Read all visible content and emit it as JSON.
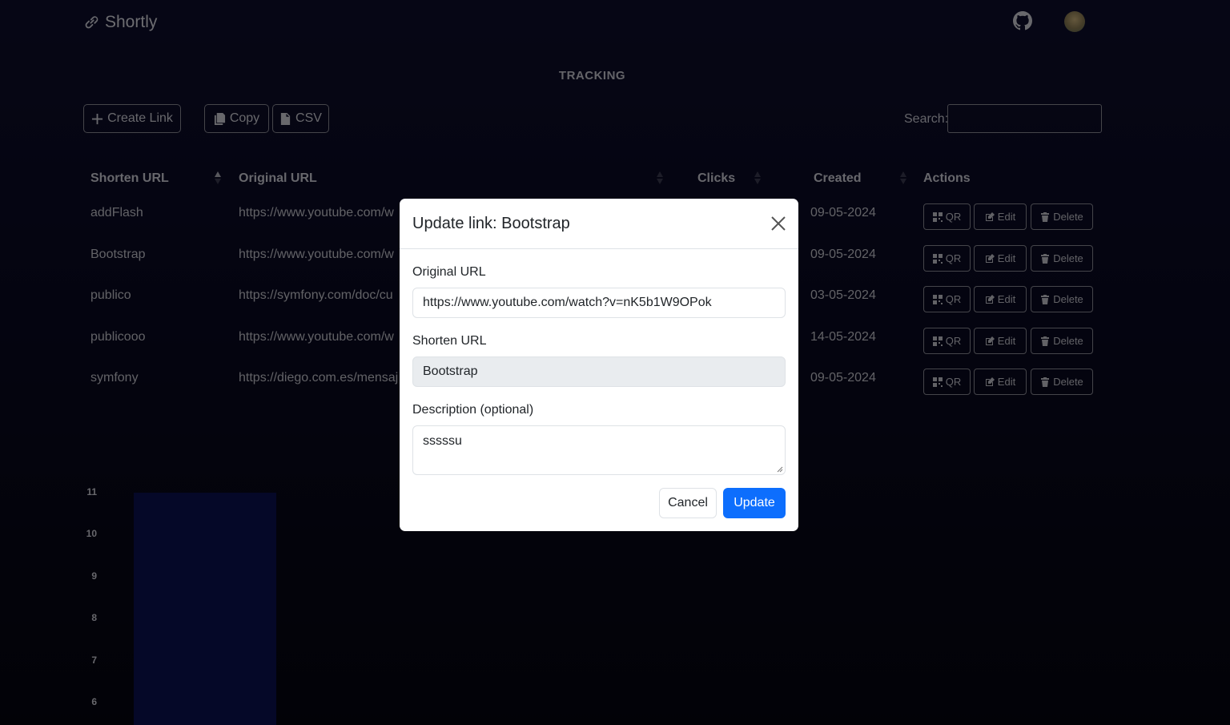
{
  "brand": {
    "name": "Shortly",
    "icon": "link-icon"
  },
  "header": {
    "github_icon": "github-icon",
    "avatar": "avatar"
  },
  "page": {
    "heading": "TRACKING"
  },
  "toolbar": {
    "create_label": "Create Link",
    "copy_label": "Copy",
    "csv_label": "CSV",
    "search_label": "Search:",
    "search_value": ""
  },
  "table": {
    "columns": [
      "Shorten URL",
      "Original URL",
      "Clicks",
      "Created",
      "Actions"
    ],
    "rows": [
      {
        "short": "addFlash",
        "original": "https://www.youtube.com/w",
        "created": "09-05-2024"
      },
      {
        "short": "Bootstrap",
        "original": "https://www.youtube.com/w",
        "created": "09-05-2024"
      },
      {
        "short": "publico",
        "original": "https://symfony.com/doc/cu",
        "created": "03-05-2024"
      },
      {
        "short": "publicooo",
        "original": "https://www.youtube.com/w",
        "created": "14-05-2024"
      },
      {
        "short": "symfony",
        "original": "https://diego.com.es/mensaj",
        "created": "09-05-2024"
      }
    ],
    "actions": {
      "qr": "QR",
      "edit": "Edit",
      "delete": "Delete"
    }
  },
  "chart_data": {
    "type": "bar",
    "y_ticks": [
      "11",
      "10",
      "9",
      "8",
      "7",
      "6"
    ],
    "ylim": [
      5.4,
      11
    ],
    "values": [
      11
    ],
    "bar_color": "#0b1150"
  },
  "modal": {
    "title": "Update link: Bootstrap",
    "original_label": "Original URL",
    "original_value": "https://www.youtube.com/watch?v=nK5b1W9OPok",
    "shorten_label": "Shorten URL",
    "shorten_value": "Bootstrap",
    "description_label": "Description (optional)",
    "description_value": "sssssu",
    "cancel_label": "Cancel",
    "update_label": "Update",
    "accent": "#0d6efd"
  }
}
